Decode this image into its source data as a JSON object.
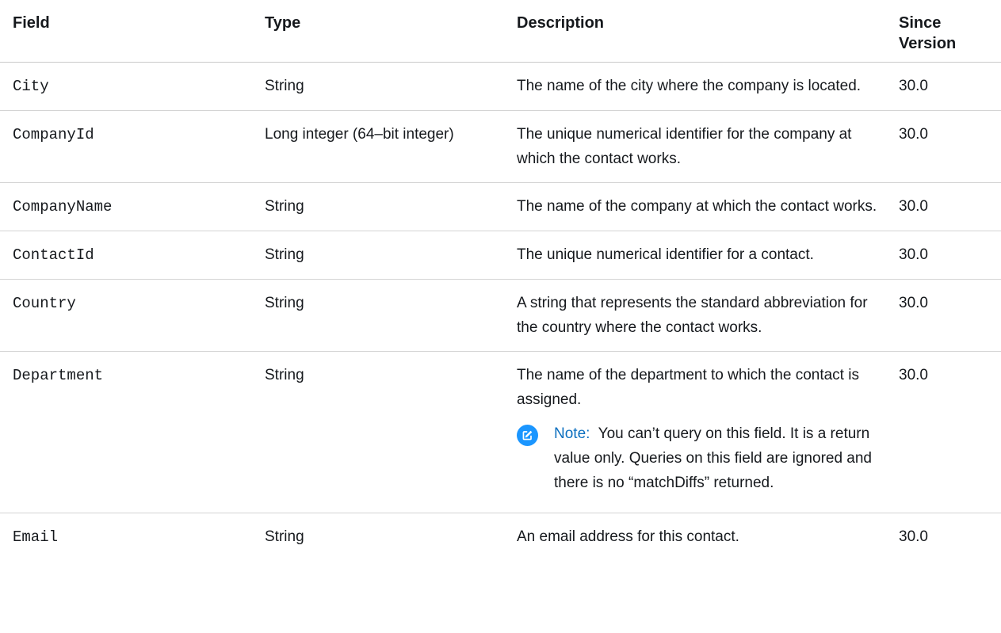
{
  "table": {
    "headers": {
      "field": "Field",
      "type": "Type",
      "description": "Description",
      "since": "Since Version"
    },
    "rows": [
      {
        "field": "City",
        "type": "String",
        "description": "The name of the city where the company is located.",
        "since": "30.0"
      },
      {
        "field": "CompanyId",
        "type": "Long integer (64–bit integer)",
        "description": "The unique numerical identifier for the company at which the contact works.",
        "since": "30.0"
      },
      {
        "field": "CompanyName",
        "type": "String",
        "description": "The name of the company at which the contact works.",
        "since": "30.0"
      },
      {
        "field": "ContactId",
        "type": "String",
        "description": "The unique numerical identifier for a contact.",
        "since": "30.0"
      },
      {
        "field": "Country",
        "type": "String",
        "description": "A string that represents the standard abbreviation for the country where the contact works.",
        "since": "30.0"
      },
      {
        "field": "Department",
        "type": "String",
        "description": "The name of the department to which the contact is assigned.",
        "since": "30.0",
        "note": {
          "label": "Note:",
          "text": "You can’t query on this field. It is a return value only. Queries on this field are ignored and there is no “matchDiffs” returned.",
          "icon": "edit-note-icon",
          "color": "#1b96ff"
        }
      },
      {
        "field": "Email",
        "type": "String",
        "description": "An email address for this contact.",
        "since": "30.0"
      }
    ]
  }
}
